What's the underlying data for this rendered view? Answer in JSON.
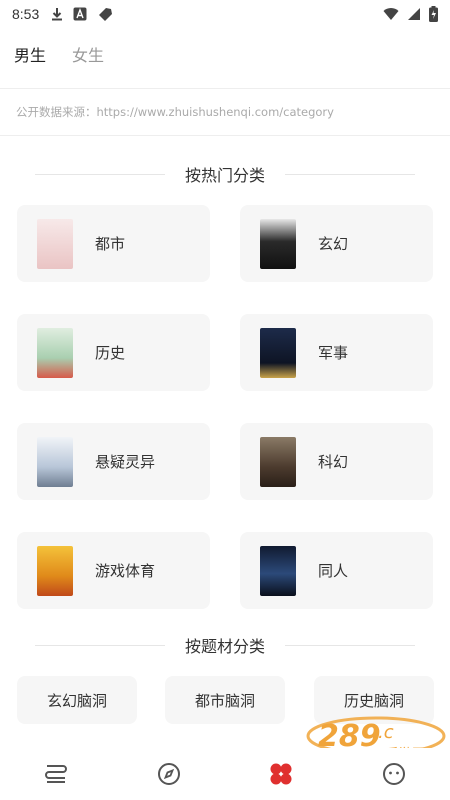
{
  "status_bar": {
    "time": "8:53"
  },
  "gender_tabs": [
    {
      "label": "男生",
      "active": true
    },
    {
      "label": "女生",
      "active": false
    }
  ],
  "source_text": "公开数据来源：https://www.zhuishushenqi.com/category",
  "hot_section_title": "按热门分类",
  "hot_categories": [
    {
      "label": "都市",
      "cover_color": "#f2d6d6"
    },
    {
      "label": "玄幻",
      "cover_color": "#2a2a2a"
    },
    {
      "label": "历史",
      "cover_color": "#cfe3d2"
    },
    {
      "label": "军事",
      "cover_color": "#1f2a44"
    },
    {
      "label": "悬疑灵异",
      "cover_color": "#cfd8e4"
    },
    {
      "label": "科幻",
      "cover_color": "#5a4636"
    },
    {
      "label": "游戏体育",
      "cover_color": "#e2a11d"
    },
    {
      "label": "同人",
      "cover_color": "#1a2a44"
    }
  ],
  "theme_section_title": "按题材分类",
  "theme_categories": [
    {
      "label": "玄幻脑洞"
    },
    {
      "label": "都市脑洞"
    },
    {
      "label": "历史脑洞"
    }
  ],
  "bottom_nav": [
    {
      "icon": "bookshelf-icon"
    },
    {
      "icon": "compass-icon"
    },
    {
      "icon": "category-icon",
      "active": true,
      "color": "#e0302f"
    },
    {
      "icon": "profile-icon"
    }
  ],
  "watermark": {
    "brand": "289",
    "sub": "手游网",
    "color": "#f0a43a"
  }
}
